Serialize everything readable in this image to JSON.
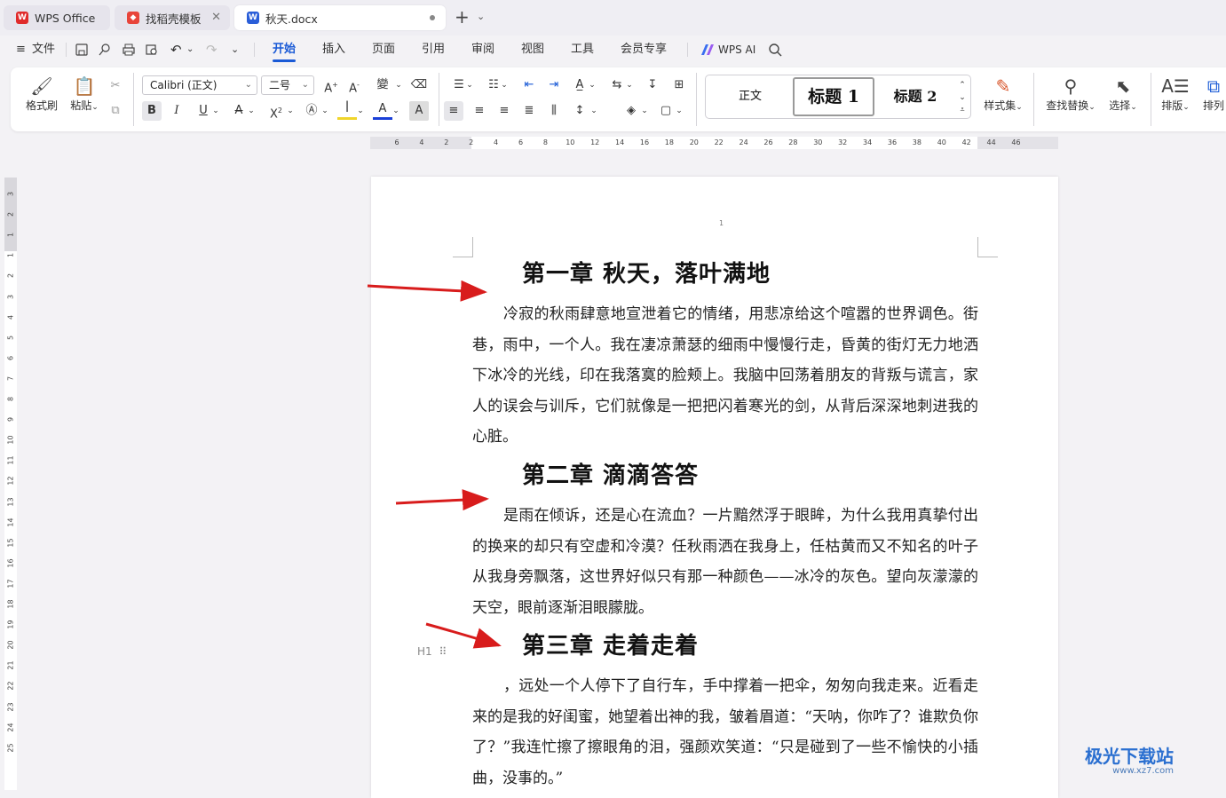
{
  "tabs": [
    {
      "label": "WPS Office"
    },
    {
      "label": "找稻壳模板"
    },
    {
      "label": "秋天.docx"
    }
  ],
  "menu": {
    "file": "文件",
    "items": [
      "开始",
      "插入",
      "页面",
      "引用",
      "审阅",
      "视图",
      "工具",
      "会员专享"
    ],
    "ai": "WPS AI"
  },
  "ribbon": {
    "format_painter": "格式刷",
    "paste": "粘贴",
    "font_name": "Calibri (正文)",
    "font_size": "二号",
    "styles": {
      "normal": "正文",
      "h1": "标题  1",
      "h2": "标题  2"
    },
    "style_set": "样式集",
    "find_replace": "查找替换",
    "select": "选择",
    "layout": "排版",
    "arrange": "排列"
  },
  "colors": {
    "accent": "#1a5ad6",
    "arrow": "#d81c1c",
    "font_color": "#1a3fd8"
  },
  "ruler": {
    "h_ticks": [
      "6",
      "4",
      "2",
      "2",
      "4",
      "6",
      "8",
      "10",
      "12",
      "14",
      "16",
      "18",
      "20",
      "22",
      "24",
      "26",
      "28",
      "30",
      "32",
      "34",
      "36",
      "38",
      "40",
      "42",
      "44",
      "46"
    ],
    "v_ticks": [
      "3",
      "2",
      "1",
      "1",
      "2",
      "3",
      "4",
      "5",
      "6",
      "7",
      "8",
      "9",
      "10",
      "11",
      "12",
      "13",
      "14",
      "15",
      "16",
      "17",
      "18",
      "19",
      "20",
      "21",
      "22",
      "23",
      "24",
      "25"
    ]
  },
  "document": {
    "page_number": "1",
    "heading_marker": "H1",
    "chapters": [
      {
        "title": "第一章  秋天，落叶满地",
        "text": "冷寂的秋雨肆意地宣泄着它的情绪，用悲凉给这个喧嚣的世界调色。街巷，雨中，一个人。我在凄凉萧瑟的细雨中慢慢行走，昏黄的街灯无力地洒下冰冷的光线，印在我落寞的脸颊上。我脑中回荡着朋友的背叛与谎言，家人的误会与训斥，它们就像是一把把闪着寒光的剑，从背后深深地刺进我的心脏。"
      },
      {
        "title": "第二章  滴滴答答",
        "text": "是雨在倾诉，还是心在流血？一片黯然浮于眼眸，为什么我用真挚付出的换来的却只有空虚和冷漠？任秋雨洒在我身上，任枯黄而又不知名的叶子从我身旁飘落，这世界好似只有那一种颜色——冰冷的灰色。望向灰濛濛的天空，眼前逐渐泪眼朦胧。"
      },
      {
        "title": "第三章  走着走着",
        "text": "，远处一个人停下了自行车，手中撑着一把伞，匆匆向我走来。近看走来的是我的好闺蜜，她望着出神的我，皱着眉道：“天呐，你咋了？谁欺负你了？”我连忙擦了擦眼角的泪，强颜欢笑道：“只是碰到了一些不愉快的小插曲，没事的。”"
      }
    ]
  },
  "watermark": {
    "title": "极光下载站",
    "url": "www.xz7.com"
  }
}
